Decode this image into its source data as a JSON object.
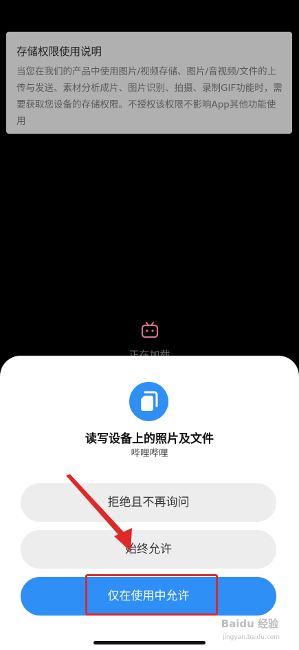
{
  "notice": {
    "title": "存储权限使用说明",
    "body": "当您在我们的产品中使用图片/视频存储、图片/音视频/文件的上传与发送、素材分析成片、图片识别、拍摄、录制GIF功能时，需要获取您设备的存储权限。不授权该权限不影响App其他功能使用"
  },
  "loading": {
    "text": "正在加载"
  },
  "permission": {
    "title": "读写设备上的照片及文件",
    "app": "哔哩哔哩",
    "icon": "file-icon",
    "accent": "#2e8ff6"
  },
  "buttons": {
    "deny": "拒绝且不再询问",
    "always": "始终允许",
    "while_using": "仅在使用中允许"
  },
  "watermark": {
    "text": "Baidu 经验",
    "sub": "jingyan.baidu.com"
  }
}
